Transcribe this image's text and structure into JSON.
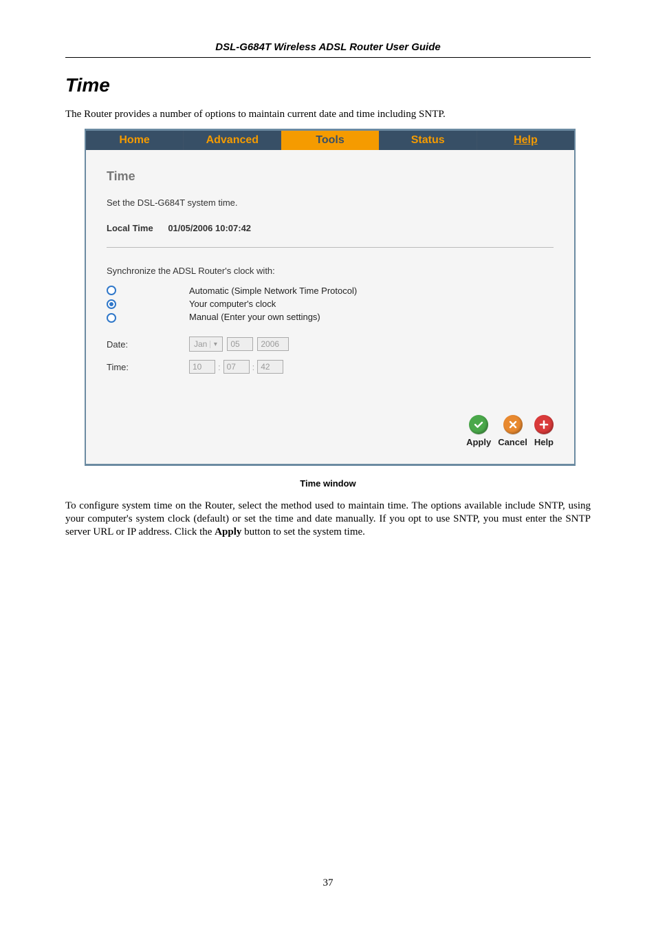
{
  "header": {
    "title": "DSL-G684T Wireless ADSL Router User Guide"
  },
  "section": {
    "heading": "Time",
    "intro": "The Router provides a number of options to maintain current date and time including SNTP."
  },
  "tabs": {
    "home": "Home",
    "advanced": "Advanced",
    "tools": "Tools",
    "status": "Status",
    "help": "Help"
  },
  "panel": {
    "title": "Time",
    "subtitle": "Set the DSL-G684T system time.",
    "local_label": "Local Time",
    "local_value": "01/05/2006 10:07:42",
    "sync_label": "Synchronize the ADSL Router's clock with:",
    "options": {
      "auto": "Automatic (Simple Network Time Protocol)",
      "computer": "Your computer's clock",
      "manual": "Manual (Enter your own settings)"
    },
    "date_label": "Date:",
    "date": {
      "month": "Jan",
      "day": "05",
      "year": "2006"
    },
    "time_label": "Time:",
    "time": {
      "hh": "10",
      "mm": "07",
      "ss": "42"
    },
    "actions": {
      "apply": "Apply",
      "cancel": "Cancel",
      "help": "Help"
    }
  },
  "caption": "Time window",
  "body": {
    "p1_a": "To configure system time on the Router, select the method used to maintain time. The options available include SNTP, using your computer's system clock (default) or set the time and date manually. If you opt to use SNTP, you must enter the SNTP server URL or IP address. Click the ",
    "p1_b": "Apply",
    "p1_c": " button to set the system time."
  },
  "page_number": "37"
}
